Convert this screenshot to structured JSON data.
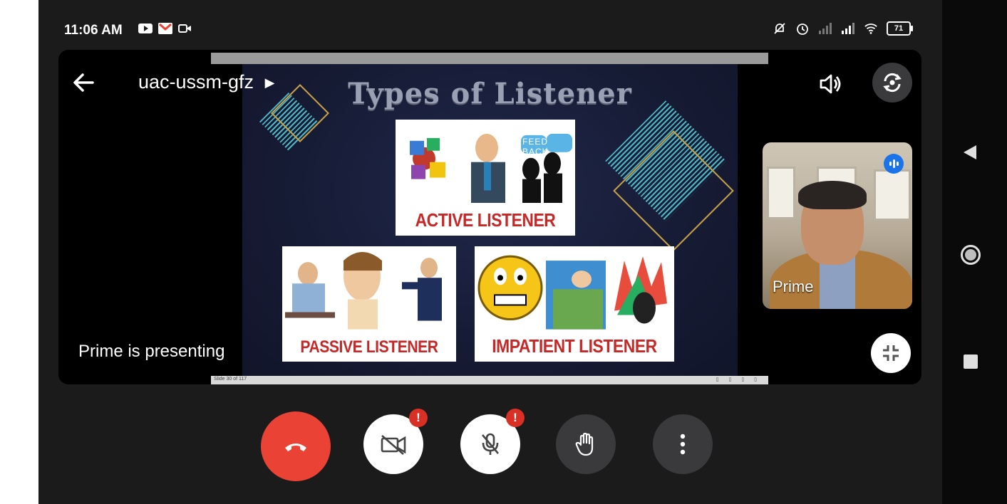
{
  "status_bar": {
    "time": "11:06 AM",
    "battery": "71"
  },
  "meeting": {
    "code": "uac-ussm-gfz",
    "presenting_text": "Prime is presenting"
  },
  "slide": {
    "title": "Types of Listener",
    "cards": [
      "ACTIVE LISTENER",
      "PASSIVE LISTENER",
      "IMPATIENT LISTENER"
    ],
    "feedback_label": "FEED BACK",
    "footer_left": "Slide 30 of 117"
  },
  "self_view": {
    "name": "Prime"
  },
  "controls": {
    "alert_mark": "!"
  },
  "colors": {
    "end_call": "#ea4335",
    "alert": "#d93025",
    "caption_red": "#c62828",
    "slide_bg": "#161b34"
  }
}
